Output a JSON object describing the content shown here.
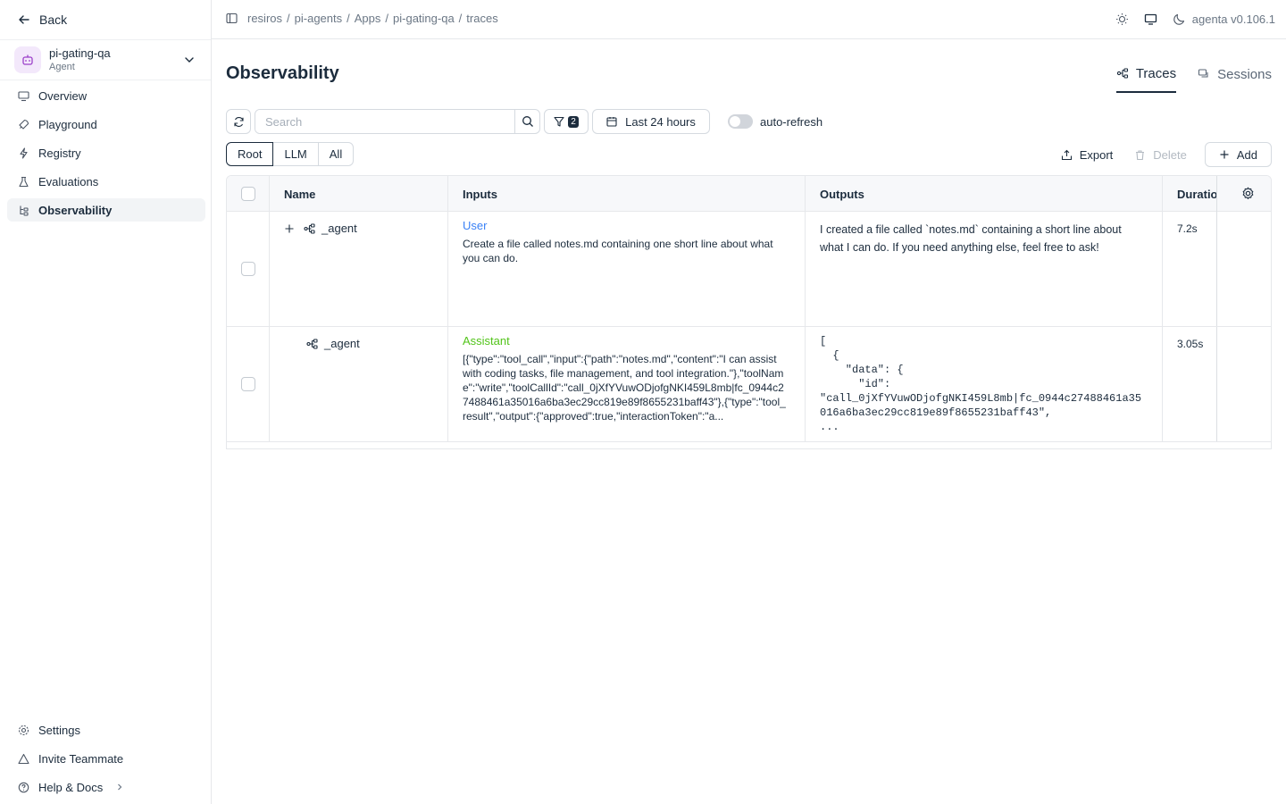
{
  "sidebar": {
    "back_label": "Back",
    "app": {
      "name": "pi-gating-qa",
      "type": "Agent"
    },
    "nav": [
      {
        "label": "Overview",
        "icon": "monitor-icon"
      },
      {
        "label": "Playground",
        "icon": "rocket-icon"
      },
      {
        "label": "Registry",
        "icon": "lightning-icon"
      },
      {
        "label": "Evaluations",
        "icon": "flask-icon"
      },
      {
        "label": "Observability",
        "icon": "tree-icon",
        "active": true
      }
    ],
    "bottom": [
      {
        "label": "Settings",
        "icon": "gear-icon"
      },
      {
        "label": "Invite Teammate",
        "icon": "triangle-icon"
      },
      {
        "label": "Help & Docs",
        "icon": "question-icon"
      }
    ]
  },
  "header": {
    "breadcrumb": [
      "resiros",
      "/",
      "pi-agents",
      "/",
      "Apps",
      "/",
      "pi-gating-qa",
      "/",
      "traces"
    ],
    "version": "agenta v0.106.1"
  },
  "page": {
    "title": "Observability",
    "tabs": [
      {
        "label": "Traces",
        "active": true
      },
      {
        "label": "Sessions",
        "active": false
      }
    ]
  },
  "toolbar": {
    "search_placeholder": "Search",
    "filter_count": "2",
    "date_range": "Last 24 hours",
    "auto_refresh_label": "auto-refresh",
    "segments": [
      "Root",
      "LLM",
      "All"
    ],
    "active_segment": "Root",
    "export_label": "Export",
    "delete_label": "Delete",
    "add_label": "Add"
  },
  "table": {
    "columns": [
      "Name",
      "Inputs",
      "Outputs",
      "Duration"
    ],
    "rows": [
      {
        "name": "_agent",
        "role": "User",
        "input": "Create a file called notes.md containing one short line about what you can do.",
        "output": "I created a file called `notes.md` containing a short line about what I can do. If you need anything else, feel free to ask!",
        "duration": "7.2s"
      },
      {
        "name": "_agent",
        "role": "Assistant",
        "input": "[{\"type\":\"tool_call\",\"input\":{\"path\":\"notes.md\",\"content\":\"I can assist with coding tasks, file management, and tool integration.\"},\"toolName\":\"write\",\"toolCallId\":\"call_0jXfYVuwODjofgNKI459L8mb|fc_0944c27488461a35016a6ba3ec29cc819e89f8655231baff43\"},{\"type\":\"tool_result\",\"output\":{\"approved\":true,\"interactionToken\":\"a...",
        "output": "[\n  {\n    \"data\": {\n      \"id\":\n\"call_0jXfYVuwODjofgNKI459L8mb|fc_0944c27488461a35\n016a6ba3ec29cc819e89f8655231baff43\",\n...",
        "duration": "3.05s"
      }
    ]
  }
}
